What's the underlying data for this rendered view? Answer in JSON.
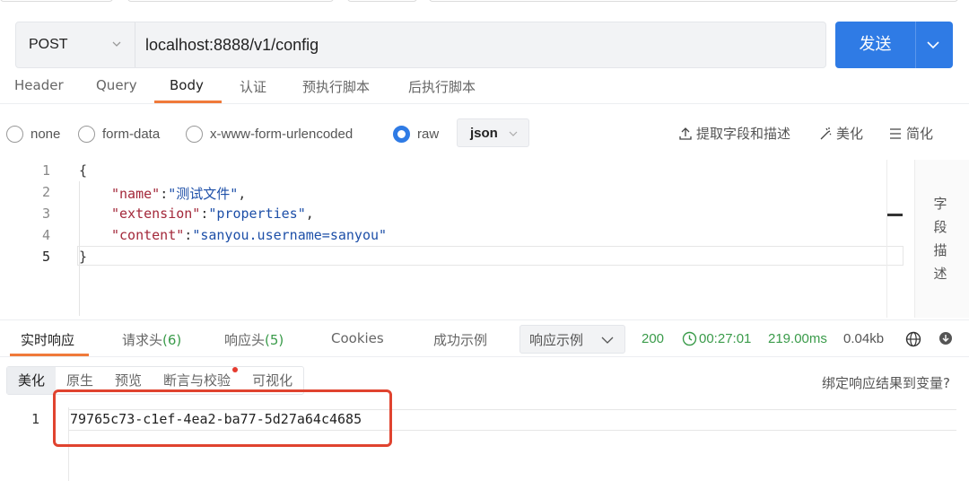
{
  "request": {
    "method": "POST",
    "url": "localhost:8888/v1/config",
    "send_label": "发送"
  },
  "request_tabs": [
    {
      "label": "Header",
      "active": false
    },
    {
      "label": "Query",
      "active": false
    },
    {
      "label": "Body",
      "active": true
    },
    {
      "label": "认证",
      "active": false
    },
    {
      "label": "预执行脚本",
      "active": false
    },
    {
      "label": "后执行脚本",
      "active": false
    }
  ],
  "body_types": [
    {
      "label": "none",
      "checked": false
    },
    {
      "label": "form-data",
      "checked": false
    },
    {
      "label": "x-www-form-urlencoded",
      "checked": false
    },
    {
      "label": "raw",
      "checked": true
    }
  ],
  "format_select": "json",
  "toolbar": {
    "extract": "提取字段和描述",
    "beautify": "美化",
    "simplify": "简化"
  },
  "editor": {
    "line_numbers": [
      "1",
      "2",
      "3",
      "4",
      "5"
    ],
    "lines": [
      {
        "open": "{"
      },
      {
        "key": "\"name\"",
        "value": "\"测试文件\""
      },
      {
        "key": "\"extension\"",
        "value": "\"properties\""
      },
      {
        "key": "\"content\"",
        "value": "\"sanyou.username=sanyou\""
      },
      {
        "close": "}"
      }
    ],
    "side_panel_label": "字段描述"
  },
  "response_tabs": {
    "live": "实时响应",
    "req_headers": "请求头",
    "req_headers_count": "(6)",
    "resp_headers": "响应头",
    "resp_headers_count": "(5)",
    "cookies": "Cookies",
    "success_example": "成功示例",
    "example_select": "响应示例"
  },
  "status": {
    "code": "200",
    "time": "00:27:01",
    "duration": "219.00ms",
    "size": "0.04kb"
  },
  "view_tabs": [
    {
      "label": "美化",
      "active": true
    },
    {
      "label": "原生",
      "active": false
    },
    {
      "label": "预览",
      "active": false
    },
    {
      "label": "断言与校验",
      "active": false,
      "dot": true
    },
    {
      "label": "可视化",
      "active": false
    }
  ],
  "bind_variable": "绑定响应结果到变量?",
  "response_body": {
    "line_number": "1",
    "text": "79765c73-c1ef-4ea2-ba77-5d27a64c4685"
  }
}
